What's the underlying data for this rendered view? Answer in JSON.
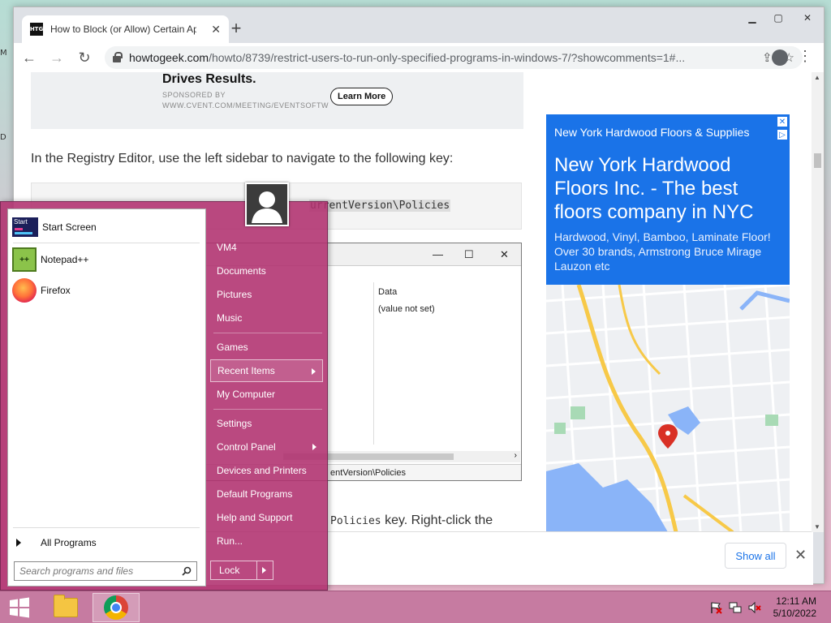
{
  "browser": {
    "tab_title": "How to Block (or Allow) Certain Applications for Users in Windows",
    "favicon_text": "HTG",
    "url_host": "howtogeek.com",
    "url_path": "/howto/8739/restrict-users-to-run-only-specified-programs-in-windows-7/?showcomments=1#..."
  },
  "page": {
    "ad_headline": "Drives Results.",
    "ad_sponsored_label": "SPONSORED BY",
    "ad_sponsored_url": "WWW.CVENT.COM/MEETING/EVENTSOFTW",
    "ad_button": "Learn More",
    "para_nav": "In the Registry Editor, use the left sidebar to navigate to the following key:",
    "code_key": "urrentVersion\\Policies",
    "reg_data_header": "Data",
    "reg_value": "(value not set)",
    "reg_status": "entVersion\\Policies",
    "para_policies_pre": "",
    "para_policies_code": "Policies",
    "para_policies_post": " key. Right-click the"
  },
  "side_ad": {
    "sponsor": "New York Hardwood Floors & Supplies",
    "title": "New York Hardwood Floors Inc. - The best floors company in NYC",
    "description": "Hardwood, Vinyl, Bamboo, Laminate Floor! Over 30 brands, Armstrong Bruce Mirage Lauzon etc",
    "colors": {
      "background": "#1a73e8",
      "pin": "#d93025"
    }
  },
  "download_bar": {
    "show_all": "Show all"
  },
  "start_menu": {
    "programs": [
      {
        "label": "Start Screen",
        "icon": "start-screen-icon"
      },
      {
        "label": "Notepad++",
        "icon": "notepad-plus-plus-icon"
      },
      {
        "label": "Firefox",
        "icon": "firefox-icon"
      }
    ],
    "start_icon_text": "Start",
    "npp_icon_text": "++",
    "all_programs": "All Programs",
    "search_placeholder": "Search programs and files",
    "right_items": [
      {
        "label": "VM4",
        "submenu": false
      },
      {
        "label": "Documents",
        "submenu": false
      },
      {
        "label": "Pictures",
        "submenu": false
      },
      {
        "label": "Music",
        "submenu": false
      },
      {
        "label": "Games",
        "submenu": false
      },
      {
        "label": "Recent Items",
        "submenu": true
      },
      {
        "label": "My Computer",
        "submenu": false
      },
      {
        "label": "Settings",
        "submenu": false
      },
      {
        "label": "Control Panel",
        "submenu": true
      },
      {
        "label": "Devices and Printers",
        "submenu": false
      },
      {
        "label": "Default Programs",
        "submenu": false
      },
      {
        "label": "Help and Support",
        "submenu": false
      },
      {
        "label": "Run...",
        "submenu": false
      }
    ],
    "lock_label": "Lock",
    "colors": {
      "panel": "#b0306e"
    }
  },
  "taskbar": {
    "time": "12:11 AM",
    "date": "5/10/2022",
    "apps": [
      "file-explorer-icon",
      "chrome-icon"
    ]
  }
}
